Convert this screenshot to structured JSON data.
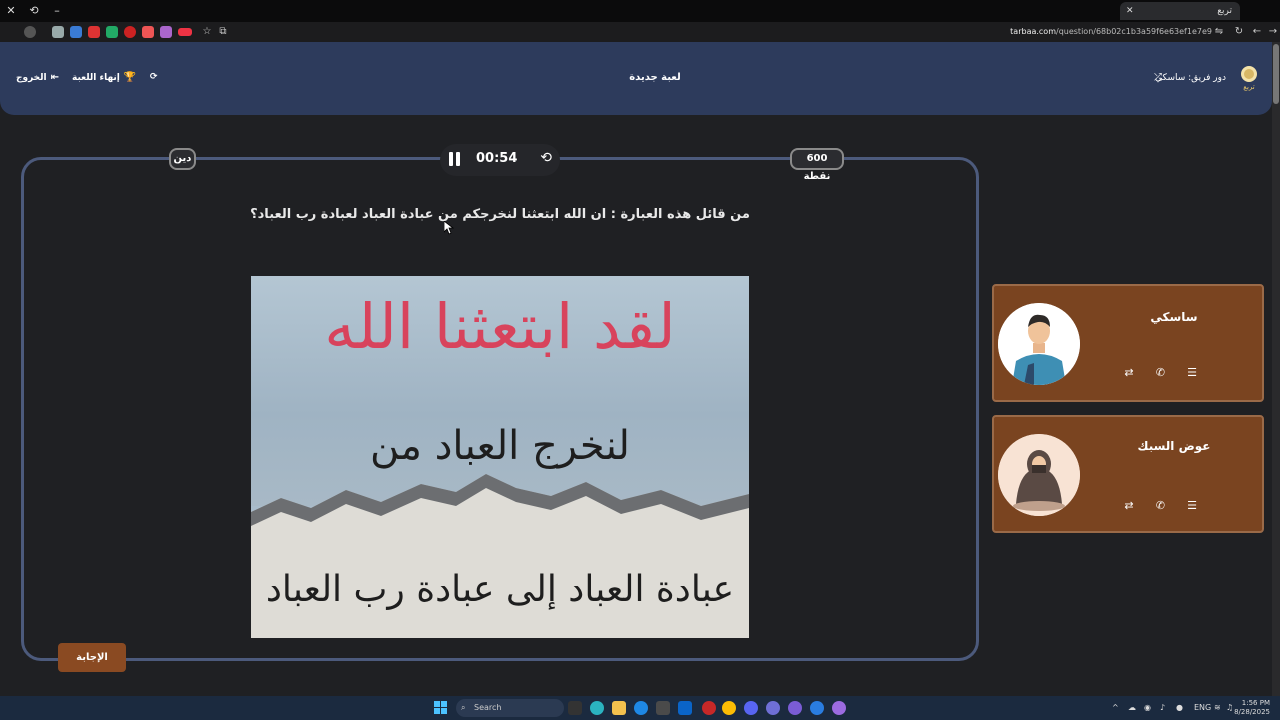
{
  "browser": {
    "tab_title": "تربع",
    "url_domain": "tarbaa.com",
    "url_path": "/question/68b02c1b3a59f6e63ef1e7e9"
  },
  "header": {
    "logo_text": "تربع",
    "turn_label": "دور فريق: ساسكي",
    "title": "لعبة جديدة",
    "end_game": "إنهاء اللعبة",
    "exit": "الخروج"
  },
  "board": {
    "category": "دين",
    "points": "600 نقطة",
    "timer": "00:54",
    "question": "من قائل هذه العبارة : ان الله ابتعثنا لنخرجكم من عبادة العباد لعبادة رب العباد؟",
    "image_text": {
      "line1": "لقد ابتعثنا الله",
      "line2": "لنخرج العباد من",
      "line3": "عبادة العباد إلى عبادة رب العباد"
    },
    "answer_button": "الإجابة"
  },
  "teams": [
    {
      "name": "ساسكي"
    },
    {
      "name": "عوض السبك"
    }
  ],
  "taskbar": {
    "search_placeholder": "Search",
    "lang": "ENG",
    "time": "1:56 PM",
    "date": "8/28/2025"
  },
  "colors": {
    "header_bg": "#2d3b5c",
    "card_bg": "#7a4420",
    "answer_bg": "#8a4a22",
    "headline_red": "#d8435c"
  }
}
